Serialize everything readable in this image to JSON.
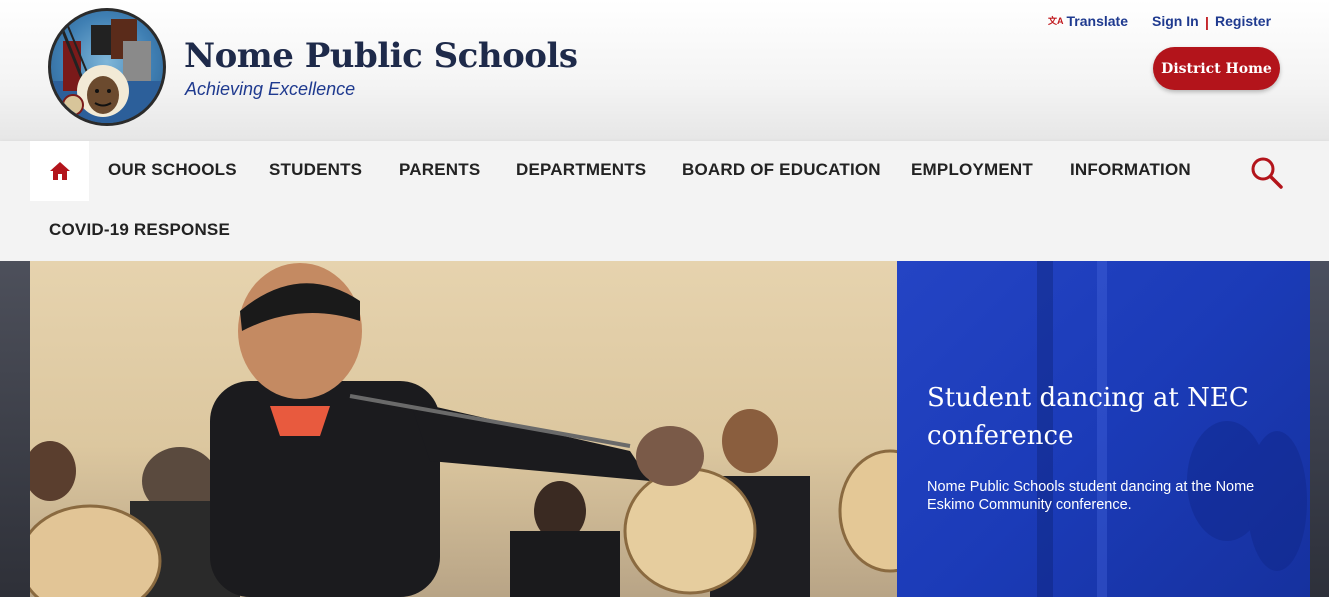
{
  "site": {
    "title": "Nome Public Schools",
    "tagline": "Achieving Excellence"
  },
  "utility": {
    "translate": "Translate",
    "sign_in": "Sign In",
    "separator": "|",
    "register": "Register",
    "district_home": "District Home"
  },
  "nav": {
    "home_icon": "home-icon",
    "search_icon": "search-icon",
    "items": [
      {
        "label": "OUR SCHOOLS"
      },
      {
        "label": "STUDENTS"
      },
      {
        "label": "PARENTS"
      },
      {
        "label": "DEPARTMENTS"
      },
      {
        "label": "BOARD OF EDUCATION"
      },
      {
        "label": "EMPLOYMENT"
      },
      {
        "label": "INFORMATION"
      },
      {
        "label": "COVID-19 RESPONSE"
      }
    ]
  },
  "hero": {
    "caption_title": "Student dancing at NEC conference",
    "caption_text": "Nome Public Schools student dancing at the Nome Eskimo Community conference."
  },
  "colors": {
    "brand_red": "#b3141b",
    "link_blue": "#1f3a8f",
    "caption_blue": "#1b3bb8"
  }
}
